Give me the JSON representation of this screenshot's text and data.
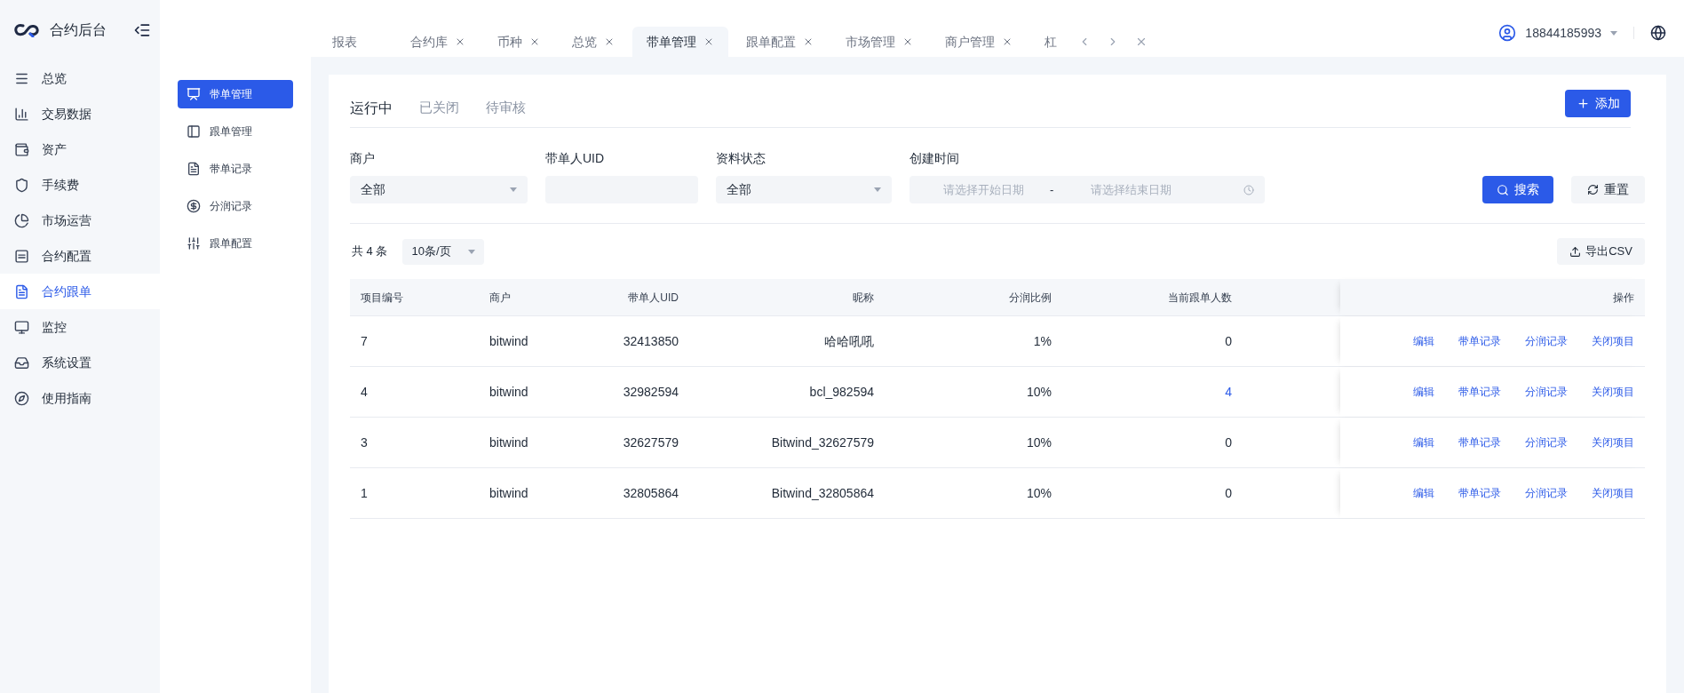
{
  "brand": {
    "title": "合约后台"
  },
  "nav": [
    {
      "label": "总览",
      "selected": false
    },
    {
      "label": "交易数据",
      "selected": false
    },
    {
      "label": "资产",
      "selected": false
    },
    {
      "label": "手续费",
      "selected": false
    },
    {
      "label": "市场运营",
      "selected": false
    },
    {
      "label": "合约配置",
      "selected": false
    },
    {
      "label": "合约跟单",
      "selected": true
    },
    {
      "label": "监控",
      "selected": false
    },
    {
      "label": "系统设置",
      "selected": false
    },
    {
      "label": "使用指南",
      "selected": false
    }
  ],
  "subnav": [
    {
      "label": "带单管理",
      "selected": true
    },
    {
      "label": "跟单管理",
      "selected": false
    },
    {
      "label": "带单记录",
      "selected": false
    },
    {
      "label": "分润记录",
      "selected": false
    },
    {
      "label": "跟单配置",
      "selected": false
    }
  ],
  "tabs": [
    {
      "label": "报表",
      "selected": false,
      "closable": false
    },
    {
      "label": "合约库",
      "selected": false,
      "closable": true
    },
    {
      "label": "币种",
      "selected": false,
      "closable": true
    },
    {
      "label": "总览",
      "selected": false,
      "closable": true
    },
    {
      "label": "带单管理",
      "selected": true,
      "closable": true
    },
    {
      "label": "跟单配置",
      "selected": false,
      "closable": true
    },
    {
      "label": "市场管理",
      "selected": false,
      "closable": true
    },
    {
      "label": "商户管理",
      "selected": false,
      "closable": true
    },
    {
      "label": "杠",
      "selected": false,
      "closable": false
    }
  ],
  "user": {
    "phone": "18844185993"
  },
  "status_tabs": [
    {
      "label": "运行中",
      "selected": true
    },
    {
      "label": "已关闭",
      "selected": false
    },
    {
      "label": "待审核",
      "selected": false
    }
  ],
  "add_button": "添加",
  "filters": [
    {
      "kind": "select",
      "label": "商户",
      "value": "全部"
    },
    {
      "kind": "input",
      "label": "带单人UID"
    },
    {
      "kind": "select",
      "label": "资料状态",
      "value": "全部"
    },
    {
      "kind": "daterange",
      "label": "创建时间",
      "start_placeholder": "请选择开始日期",
      "separator": "-",
      "end_placeholder": "请选择结束日期"
    }
  ],
  "search_button": "搜索",
  "reset_button": "重置",
  "total": "共 4 条",
  "page_size": "10条/页",
  "export_button": "导出CSV",
  "table": {
    "columns": [
      "项目编号",
      "商户",
      "带单人UID",
      "昵称",
      "分润比例",
      "当前跟单人数",
      "操作"
    ],
    "rows": [
      {
        "cells": [
          "7",
          "bitwind",
          "32413850",
          "哈哈吼吼",
          "1%",
          "0"
        ],
        "followers_link": false,
        "actions": [
          "编辑",
          "带单记录",
          "分润记录",
          "关闭项目"
        ]
      },
      {
        "cells": [
          "4",
          "bitwind",
          "32982594",
          "bcl_982594",
          "10%",
          "4"
        ],
        "followers_link": true,
        "actions": [
          "编辑",
          "带单记录",
          "分润记录",
          "关闭项目"
        ]
      },
      {
        "cells": [
          "3",
          "bitwind",
          "32627579",
          "Bitwind_32627579",
          "10%",
          "0"
        ],
        "followers_link": false,
        "actions": [
          "编辑",
          "带单记录",
          "分润记录",
          "关闭项目"
        ]
      },
      {
        "cells": [
          "1",
          "bitwind",
          "32805864",
          "Bitwind_32805864",
          "10%",
          "0"
        ],
        "followers_link": false,
        "actions": [
          "编辑",
          "带单记录",
          "分润记录",
          "关闭项目"
        ]
      }
    ]
  }
}
